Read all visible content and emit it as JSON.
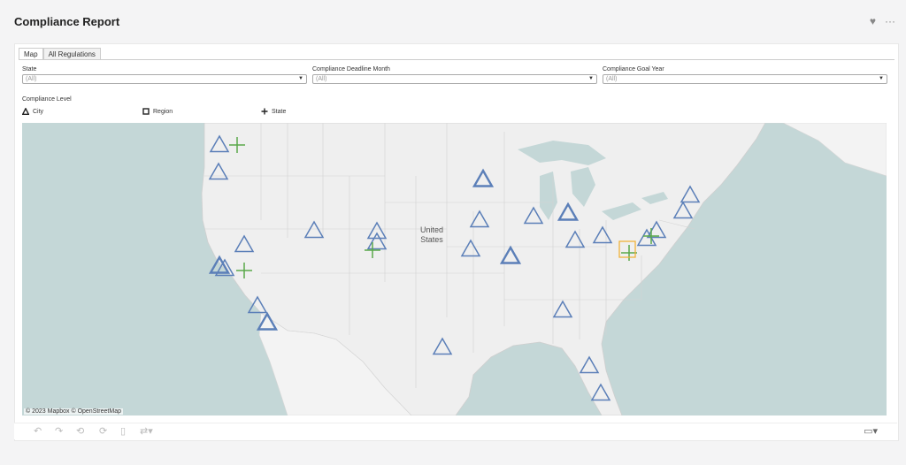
{
  "page": {
    "title": "Compliance Report"
  },
  "tabs": [
    "Map",
    "All Regulations"
  ],
  "filters": [
    {
      "label": "State",
      "value": "(All)"
    },
    {
      "label": "Compliance Deadline Month",
      "value": "(All)"
    },
    {
      "label": "Compliance Goal Year",
      "value": "(All)"
    }
  ],
  "legend": {
    "title": "Compliance Level",
    "items": [
      {
        "label": "City",
        "shape": "triangle"
      },
      {
        "label": "Region",
        "shape": "square"
      },
      {
        "label": "State",
        "shape": "plus"
      }
    ]
  },
  "map": {
    "country_label_1": "United",
    "country_label_2": "States",
    "attribution": "© 2023 Mapbox  © OpenStreetMap"
  },
  "colors": {
    "city": "#5b7fb8",
    "region": "#f0b23a",
    "state": "#5aa84a",
    "water": "#c4d7d7",
    "land": "#efefef"
  },
  "icons": {
    "heart": "heart-icon",
    "more": "more-icon",
    "undo": "undo-icon",
    "redo": "redo-icon",
    "revert": "revert-icon",
    "refresh": "refresh-data-icon",
    "pause": "pause-updates-icon",
    "share": "share-icon",
    "presentation": "presentation-icon"
  }
}
